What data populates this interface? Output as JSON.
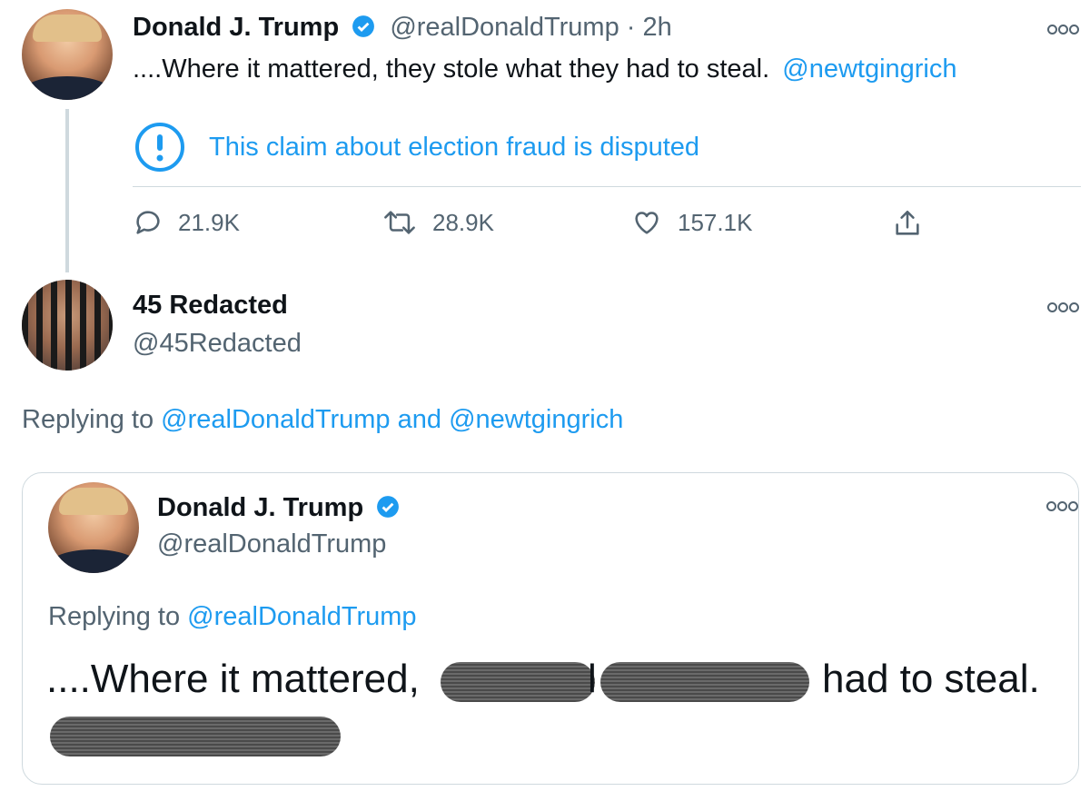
{
  "tweet1": {
    "name": "Donald J. Trump",
    "handle_time": "@realDonaldTrump · 2h",
    "text": "....Where it mattered, they stole what they had to steal.",
    "mention": "@newtgingrich",
    "warning": "This claim about election fraud is disputed",
    "replies": "21.9K",
    "retweets": "28.9K",
    "likes": "157.1K",
    "icons": [
      "reply-icon",
      "retweet-icon",
      "like-icon",
      "share-icon",
      "more-icon",
      "verified-icon",
      "info-icon"
    ]
  },
  "tweet2": {
    "name": "45 Redacted",
    "handle": "@45Redacted",
    "replying_prefix": "Replying to",
    "replying_handle1": "@realDonaldTrump",
    "replying_and": "and",
    "replying_handle2": "@newtgingrich"
  },
  "quoted": {
    "name": "Donald J. Trump",
    "handle": "@realDonaldTrump",
    "replying_prefix": "Replying to",
    "replying_handle": "@realDonaldTrump",
    "text_start": "....Where it mattered,",
    "text_mid": "l",
    "text_end": "had to steal."
  },
  "colors": {
    "link": "#1d9bf0",
    "muted": "#536471",
    "text": "#0f1419",
    "border": "#cfd9de"
  }
}
